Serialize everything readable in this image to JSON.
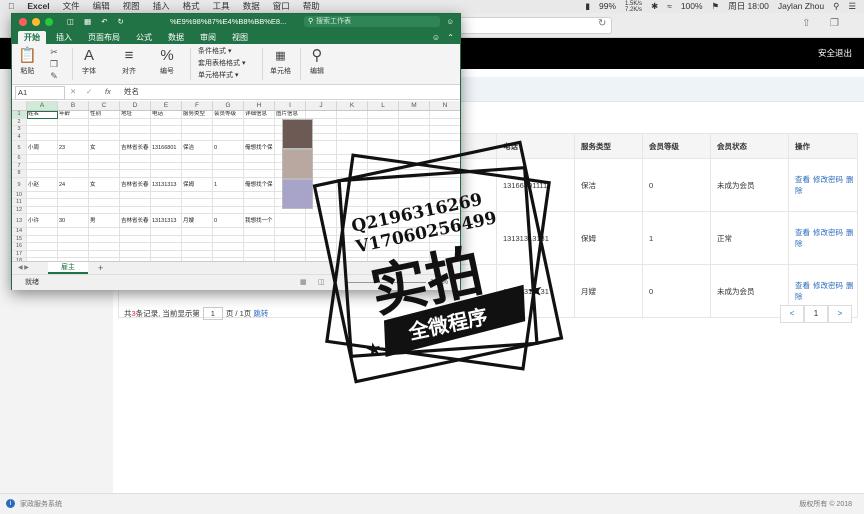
{
  "menubar": {
    "app": "Excel",
    "items": [
      "文件",
      "编辑",
      "视图",
      "插入",
      "格式",
      "工具",
      "数据",
      "窗口",
      "帮助"
    ],
    "battery": "99%",
    "net_up": "1.5K/s",
    "net_down": "7.2K/s",
    "wifi_pct": "100%",
    "clock": "周日 18:00",
    "user": "Jaylan Zhou"
  },
  "browser": {
    "logout_label": "安全退出"
  },
  "members_table": {
    "headers": [
      "电话",
      "服务类型",
      "会员等级",
      "会员状态",
      "操作"
    ],
    "rows": [
      {
        "phone": "13166801111",
        "service": "保洁",
        "level": "0",
        "status": "未成为会员"
      },
      {
        "phone": "13131313131",
        "service": "保姆",
        "level": "1",
        "status": "正常"
      },
      {
        "phone": "13131313131",
        "service": "月嫂",
        "level": "0",
        "status": "未成为会员"
      }
    ],
    "ops": [
      "查看",
      "修改密码",
      "删除"
    ]
  },
  "pager": {
    "prefix": "共",
    "count": "3",
    "mid": "条记录,  当前显示第",
    "page": "1",
    "suffix": "页 / 1页",
    "jump": "跳转",
    "prev": "<",
    "current": "1",
    "next": ">"
  },
  "footer": {
    "left": "家政服务系统",
    "right": "版权所有 © 2018"
  },
  "excel": {
    "filename": "%E9%98%87%E4%B8%BB%E8...",
    "search_placeholder": "搜索工作表",
    "tabs": [
      "开始",
      "插入",
      "页面布局",
      "公式",
      "数据",
      "审阅",
      "视图"
    ],
    "ribbon": {
      "paste": "粘贴",
      "font": "字体",
      "align": "对齐",
      "number": "编号",
      "cond_format": "条件格式 ▾",
      "table_format": "套用表格格式 ▾",
      "cell_style": "单元格样式 ▾",
      "cells": "单元格",
      "edit": "编辑"
    },
    "namebox": "A1",
    "fx": "fx",
    "formula_value": "姓名",
    "columns": [
      "A",
      "B",
      "C",
      "D",
      "E",
      "F",
      "G",
      "H",
      "I",
      "J",
      "K",
      "L",
      "M",
      "N"
    ],
    "rows": [
      [
        "1",
        "姓名",
        "年龄",
        "性别",
        "地址",
        "电话",
        "服务类型",
        "会员等级",
        "详细信息",
        "图片信息",
        "",
        "",
        "",
        "",
        ""
      ],
      [
        "2",
        "",
        "",
        "",
        "",
        "",
        "",
        "",
        "",
        "",
        "",
        "",
        "",
        "",
        ""
      ],
      [
        "3",
        "",
        "",
        "",
        "",
        "",
        "",
        "",
        "",
        "",
        "",
        "",
        "",
        "",
        ""
      ],
      [
        "4",
        "",
        "",
        "",
        "",
        "",
        "",
        "",
        "",
        "",
        "",
        "",
        "",
        "",
        ""
      ],
      [
        "5",
        "小周",
        "23",
        "女",
        "吉林省长春",
        "13166801",
        "保洁",
        "0",
        "俺想找个保",
        "",
        "",
        "",
        "",
        "",
        ""
      ],
      [
        "6",
        "",
        "",
        "",
        "",
        "",
        "",
        "",
        "",
        "",
        "",
        "",
        "",
        "",
        ""
      ],
      [
        "7",
        "",
        "",
        "",
        "",
        "",
        "",
        "",
        "",
        "",
        "",
        "",
        "",
        "",
        ""
      ],
      [
        "8",
        "",
        "",
        "",
        "",
        "",
        "",
        "",
        "",
        "",
        "",
        "",
        "",
        "",
        ""
      ],
      [
        "9",
        "小赵",
        "24",
        "女",
        "吉林省长春",
        "13131313",
        "保姆",
        "1",
        "俺想找个保",
        "",
        "",
        "",
        "",
        "",
        ""
      ],
      [
        "10",
        "",
        "",
        "",
        "",
        "",
        "",
        "",
        "",
        "",
        "",
        "",
        "",
        "",
        ""
      ],
      [
        "11",
        "",
        "",
        "",
        "",
        "",
        "",
        "",
        "",
        "",
        "",
        "",
        "",
        "",
        ""
      ],
      [
        "12",
        "",
        "",
        "",
        "",
        "",
        "",
        "",
        "",
        "",
        "",
        "",
        "",
        "",
        ""
      ],
      [
        "13",
        "小许",
        "30",
        "男",
        "吉林省长春",
        "13131313",
        "月嫂",
        "0",
        "我想找一个",
        "",
        "",
        "",
        "",
        "",
        ""
      ],
      [
        "14",
        "",
        "",
        "",
        "",
        "",
        "",
        "",
        "",
        "",
        "",
        "",
        "",
        "",
        ""
      ],
      [
        "15",
        "",
        "",
        "",
        "",
        "",
        "",
        "",
        "",
        "",
        "",
        "",
        "",
        "",
        ""
      ],
      [
        "16",
        "",
        "",
        "",
        "",
        "",
        "",
        "",
        "",
        "",
        "",
        "",
        "",
        "",
        ""
      ],
      [
        "17",
        "",
        "",
        "",
        "",
        "",
        "",
        "",
        "",
        "",
        "",
        "",
        "",
        "",
        ""
      ],
      [
        "18",
        "",
        "",
        "",
        "",
        "",
        "",
        "",
        "",
        "",
        "",
        "",
        "",
        "",
        ""
      ],
      [
        "19",
        "",
        "",
        "",
        "",
        "",
        "",
        "",
        "",
        "",
        "",
        "",
        "",
        "",
        ""
      ],
      [
        "20",
        "",
        "",
        "",
        "",
        "",
        "",
        "",
        "",
        "",
        "",
        "",
        "",
        "",
        ""
      ]
    ],
    "sheet_name": "雇主",
    "status": "就绪",
    "zoom": "100%"
  },
  "watermark": {
    "line1": "Q2196316269",
    "line2": "V17060256499",
    "big": "实拍",
    "banner": "全微程序"
  }
}
